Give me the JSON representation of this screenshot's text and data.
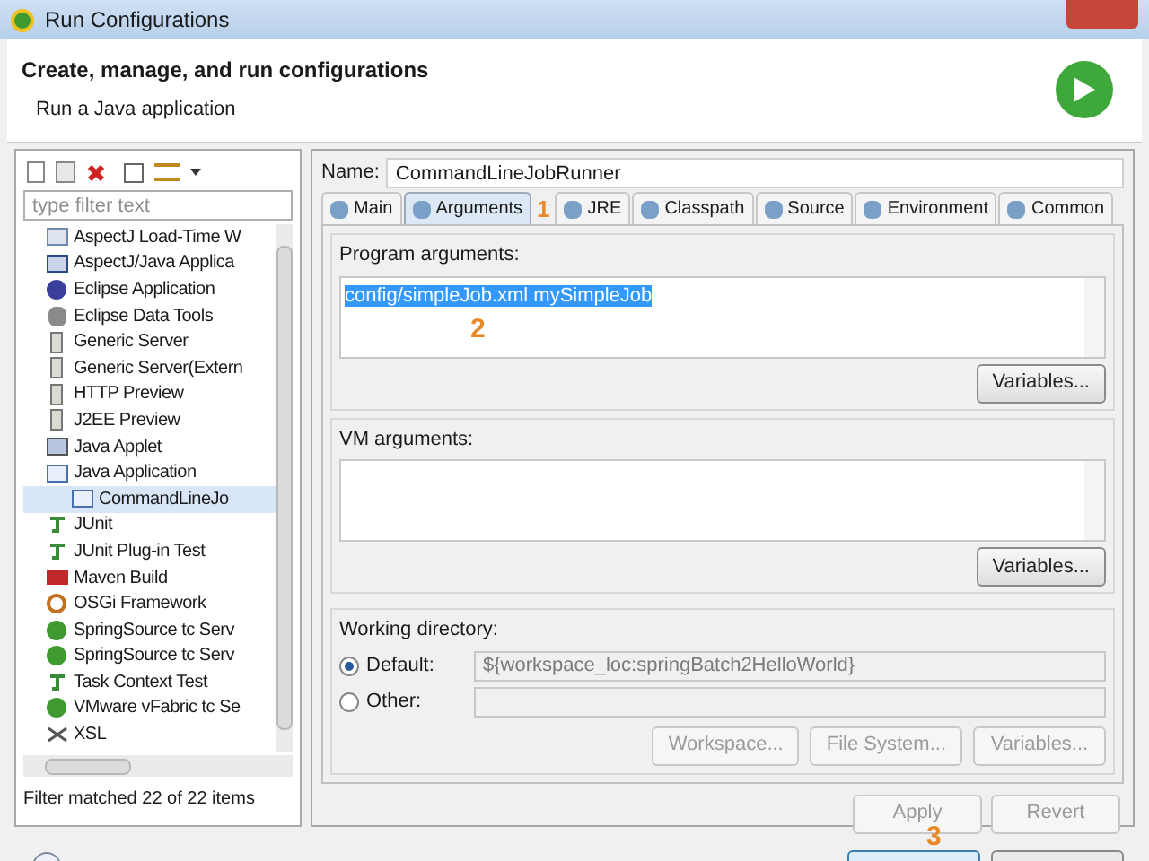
{
  "window": {
    "title": "Run Configurations"
  },
  "header": {
    "title": "Create, manage, and run configurations",
    "subtitle": "Run a Java application"
  },
  "sidebar": {
    "filter_placeholder": "type filter text",
    "items": [
      {
        "label": "AspectJ Load-Time W",
        "kind": "ltw",
        "selected": false
      },
      {
        "label": "AspectJ/Java Applica",
        "kind": "aj",
        "selected": false
      },
      {
        "label": "Eclipse Application",
        "kind": "eclipse",
        "selected": false
      },
      {
        "label": "Eclipse Data Tools",
        "kind": "db",
        "selected": false
      },
      {
        "label": "Generic Server",
        "kind": "server",
        "selected": false
      },
      {
        "label": "Generic Server(Extern",
        "kind": "server",
        "selected": false
      },
      {
        "label": "HTTP Preview",
        "kind": "server",
        "selected": false
      },
      {
        "label": "J2EE Preview",
        "kind": "server",
        "selected": false
      },
      {
        "label": "Java Applet",
        "kind": "applet",
        "selected": false
      },
      {
        "label": "Java Application",
        "kind": "java",
        "selected": false,
        "children": [
          {
            "label": "CommandLineJo",
            "kind": "java",
            "selected": true
          }
        ]
      },
      {
        "label": "JUnit",
        "kind": "junit",
        "selected": false
      },
      {
        "label": "JUnit Plug-in Test",
        "kind": "junit",
        "selected": false
      },
      {
        "label": "Maven Build",
        "kind": "m2",
        "selected": false
      },
      {
        "label": "OSGi Framework",
        "kind": "osgi",
        "selected": false
      },
      {
        "label": "SpringSource tc Serv",
        "kind": "spring",
        "selected": false
      },
      {
        "label": "SpringSource tc Serv",
        "kind": "spring",
        "selected": false
      },
      {
        "label": "Task Context Test",
        "kind": "junit",
        "selected": false
      },
      {
        "label": "VMware vFabric tc Se",
        "kind": "spring",
        "selected": false
      },
      {
        "label": "XSL",
        "kind": "xsl",
        "selected": false
      }
    ],
    "status": "Filter matched 22 of 22 items"
  },
  "name": {
    "label": "Name:",
    "value": "CommandLineJobRunner"
  },
  "tabs": [
    {
      "label": "Main",
      "selected": false
    },
    {
      "label": "Arguments",
      "selected": true
    },
    {
      "label": "JRE",
      "selected": false
    },
    {
      "label": "Classpath",
      "selected": false
    },
    {
      "label": "Source",
      "selected": false
    },
    {
      "label": "Environment",
      "selected": false
    },
    {
      "label": "Common",
      "selected": false
    }
  ],
  "program_arguments": {
    "label": "Program arguments:",
    "value": "config/simpleJob.xml mySimpleJob",
    "button": "Variables..."
  },
  "vm_arguments": {
    "label": "VM arguments:",
    "button": "Variables..."
  },
  "working_directory": {
    "label": "Working directory:",
    "options": [
      {
        "label": "Default:",
        "selected": true,
        "value": "${workspace_loc:springBatch2HelloWorld}"
      },
      {
        "label": "Other:",
        "selected": false
      }
    ],
    "buttons": [
      "Workspace...",
      "File System...",
      "Variables..."
    ]
  },
  "actions": [
    {
      "label": "Apply",
      "disabled": true
    },
    {
      "label": "Revert",
      "disabled": true
    }
  ],
  "annotations": [
    "1",
    "2",
    "3"
  ]
}
